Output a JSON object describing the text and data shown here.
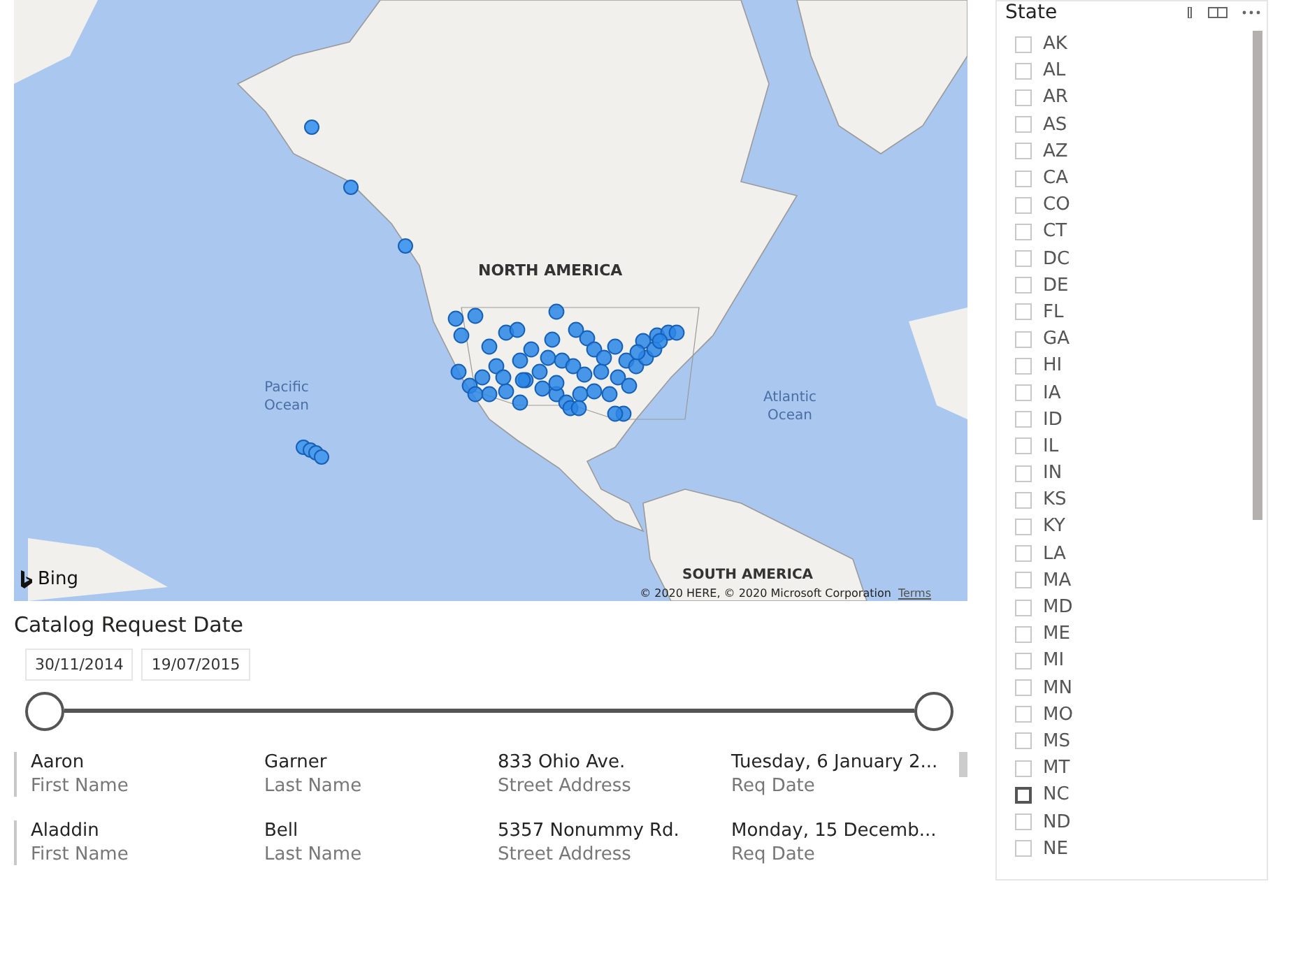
{
  "map": {
    "labels": [
      {
        "kind": "continent",
        "text": "NORTH AMERICA"
      },
      {
        "kind": "ocean",
        "text": "Pacific Ocean"
      },
      {
        "kind": "ocean",
        "text": "Atlantic Ocean"
      },
      {
        "kind": "continent-cut",
        "text": "SOUTH AMERICA"
      }
    ],
    "brand": "Bing",
    "copyright": "© 2020 HERE, © 2020 Microsoft Corporation",
    "terms_link": "Terms"
  },
  "date_slicer": {
    "title": "Catalog Request Date",
    "start": "30/11/2014",
    "end": "19/07/2015",
    "thumbs": [
      {
        "level": 0
      },
      {
        "level": 1
      }
    ]
  },
  "records": [
    {
      "fields": [
        {
          "value": "Aaron",
          "label": "First Name"
        },
        {
          "value": "Garner",
          "label": "Last Name"
        },
        {
          "value": "833 Ohio Ave.",
          "label": "Street Address"
        },
        {
          "value": "Tuesday, 6 January 2...",
          "label": "Req Date"
        }
      ]
    },
    {
      "fields": [
        {
          "value": "Aladdin",
          "label": "First Name"
        },
        {
          "value": "Bell",
          "label": "Last Name"
        },
        {
          "value": "5357 Nonummy Rd.",
          "label": "Street Address"
        },
        {
          "value": "Monday, 15 Decemb...",
          "label": "Req Date"
        }
      ]
    }
  ],
  "state_slicer": {
    "title": "State",
    "items": [
      {
        "label": "AK",
        "checked": false,
        "hovered": false
      },
      {
        "label": "AL",
        "checked": false,
        "hovered": false
      },
      {
        "label": "AR",
        "checked": false,
        "hovered": false
      },
      {
        "label": "AS",
        "checked": false,
        "hovered": false
      },
      {
        "label": "AZ",
        "checked": false,
        "hovered": false
      },
      {
        "label": "CA",
        "checked": false,
        "hovered": false
      },
      {
        "label": "CO",
        "checked": false,
        "hovered": false
      },
      {
        "label": "CT",
        "checked": false,
        "hovered": false
      },
      {
        "label": "DC",
        "checked": false,
        "hovered": false
      },
      {
        "label": "DE",
        "checked": false,
        "hovered": false
      },
      {
        "label": "FL",
        "checked": false,
        "hovered": false
      },
      {
        "label": "GA",
        "checked": false,
        "hovered": false
      },
      {
        "label": "HI",
        "checked": false,
        "hovered": false
      },
      {
        "label": "IA",
        "checked": false,
        "hovered": false
      },
      {
        "label": "ID",
        "checked": false,
        "hovered": false
      },
      {
        "label": "IL",
        "checked": false,
        "hovered": false
      },
      {
        "label": "IN",
        "checked": false,
        "hovered": false
      },
      {
        "label": "KS",
        "checked": false,
        "hovered": false
      },
      {
        "label": "KY",
        "checked": false,
        "hovered": false
      },
      {
        "label": "LA",
        "checked": false,
        "hovered": false
      },
      {
        "label": "MA",
        "checked": false,
        "hovered": false
      },
      {
        "label": "MD",
        "checked": false,
        "hovered": false
      },
      {
        "label": "ME",
        "checked": false,
        "hovered": false
      },
      {
        "label": "MI",
        "checked": false,
        "hovered": false
      },
      {
        "label": "MN",
        "checked": false,
        "hovered": false
      },
      {
        "label": "MO",
        "checked": false,
        "hovered": false
      },
      {
        "label": "MS",
        "checked": false,
        "hovered": false
      },
      {
        "label": "MT",
        "checked": false,
        "hovered": false
      },
      {
        "label": "NC",
        "checked": false,
        "hovered": true
      },
      {
        "label": "ND",
        "checked": false,
        "hovered": false
      },
      {
        "label": "NE",
        "checked": false,
        "hovered": false
      }
    ]
  }
}
